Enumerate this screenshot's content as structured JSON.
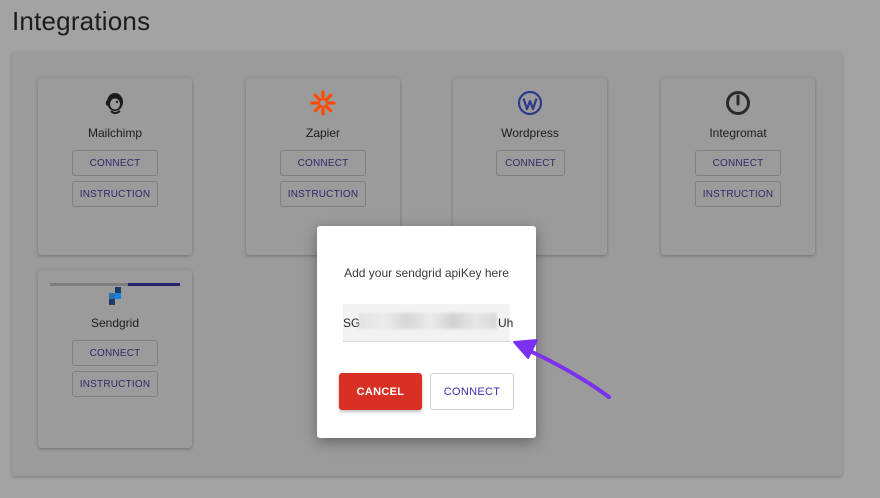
{
  "page": {
    "title": "Integrations"
  },
  "integrations": [
    {
      "name": "Mailchimp",
      "icon": "mailchimp-icon",
      "connect_label": "CONNECT",
      "instruction_label": "INSTRUCTION"
    },
    {
      "name": "Zapier",
      "icon": "zapier-icon",
      "connect_label": "CONNECT",
      "instruction_label": "INSTRUCTION"
    },
    {
      "name": "Wordpress",
      "icon": "wordpress-icon",
      "connect_label": "CONNECT"
    },
    {
      "name": "Integromat",
      "icon": "integromat-icon",
      "connect_label": "CONNECT",
      "instruction_label": "INSTRUCTION"
    },
    {
      "name": "Sendgrid",
      "icon": "sendgrid-icon",
      "connect_label": "CONNECT",
      "instruction_label": "INSTRUCTION"
    }
  ],
  "modal": {
    "prompt": "Add your sendgrid apiKey here",
    "api_key_prefix": "SG",
    "api_key_suffix": "Uh",
    "cancel_label": "CANCEL",
    "connect_label": "CONNECT"
  },
  "colors": {
    "cancel": "#d93025",
    "link": "#3b2fb0",
    "annotation_arrow": "#7b2ff0",
    "zapier": "#ff4a00",
    "wordpress": "#21759b",
    "sendgrid": "#1a82e2"
  }
}
